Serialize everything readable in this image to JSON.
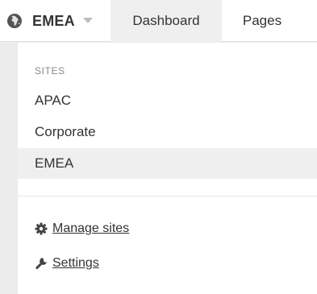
{
  "topbar": {
    "current_site": "EMEA",
    "tabs": [
      {
        "label": "Dashboard"
      },
      {
        "label": "Pages"
      }
    ]
  },
  "dropdown": {
    "heading": "SITES",
    "sites": [
      {
        "label": "APAC"
      },
      {
        "label": "Corporate"
      },
      {
        "label": "EMEA",
        "active": true
      }
    ],
    "actions": [
      {
        "label": "Manage sites",
        "icon": "gear-icon"
      },
      {
        "label": "Settings",
        "icon": "wrench-icon"
      }
    ]
  },
  "colors": {
    "text": "#333333",
    "muted": "#888888",
    "active_bg": "#efefef",
    "page_bg": "#ececec"
  }
}
